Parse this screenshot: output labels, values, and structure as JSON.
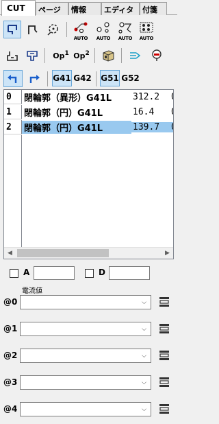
{
  "tabs": [
    {
      "label": "CUT",
      "active": true
    },
    {
      "label": "ページ",
      "active": false
    },
    {
      "label": "情報",
      "active": false
    },
    {
      "label": "エディタ",
      "active": false
    },
    {
      "label": "付箋",
      "active": false
    }
  ],
  "toolbar1": {
    "auto_labels": [
      "AUTO",
      "AUTO",
      "AUTO",
      "AUTO"
    ]
  },
  "toolbar2": {
    "op1": "Op",
    "op1_sup": "1",
    "op2": "Op",
    "op2_sup": "2"
  },
  "toolbar3": {
    "g41": "G41",
    "g42": "G42",
    "g51": "G51",
    "g52": "G52"
  },
  "cut_list": {
    "rows": [
      {
        "index": "0",
        "name": "閉輪郭（異形）G41L",
        "value": "312.2",
        "more": "0",
        "selected": false
      },
      {
        "index": "1",
        "name": "閉輪郭（円）G41L",
        "value": "16.4",
        "more": "0",
        "selected": false
      },
      {
        "index": "2",
        "name": "閉輪郭（円）G41L",
        "value": "139.7",
        "more": "0",
        "selected": true
      }
    ],
    "scroll_left": "◀",
    "scroll_right": "▶"
  },
  "fields": {
    "a_label": "A",
    "a_value": "",
    "d_label": "D",
    "d_value": "",
    "current_label": "電流値"
  },
  "at_rows": [
    {
      "label": "@0",
      "value": ""
    },
    {
      "label": "@1",
      "value": ""
    },
    {
      "label": "@2",
      "value": ""
    },
    {
      "label": "@3",
      "value": ""
    },
    {
      "label": "@4",
      "value": ""
    }
  ],
  "colors": {
    "selected_row": "#99c9ef",
    "selected_button": "#cce4f7",
    "accent_blue": "#1a5fcc"
  }
}
